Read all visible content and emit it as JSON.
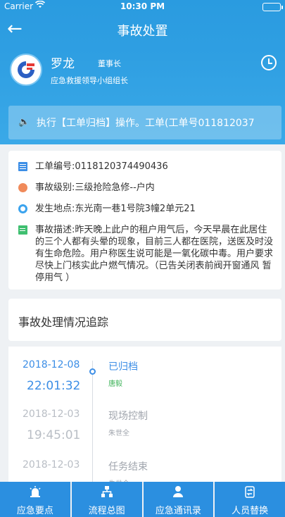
{
  "statusbar": {
    "carrier": "Carrier",
    "time": "10:30 PM"
  },
  "navbar": {
    "back_icon": "←",
    "title": "事故处置"
  },
  "profile": {
    "name": "罗龙",
    "title": "董事长",
    "role": "应急救援领导小组组长"
  },
  "notice": {
    "icon": "🔈",
    "text": "执行【工单归档】操作。工单(工单号011812037"
  },
  "info": {
    "order_no": "工单编号:0118120374490436",
    "level": "事故级别:三级抢险急修--户内",
    "location": "发生地点:东光南一巷1号院3幢2单元21",
    "description": "事故描述:昨天晚上此户的租户用气后，今天早晨在此居住的三个人都有头晕的现象，目前三人都在医院，送医及时没有生命危险。用户称医生说可能是一氧化碳中毒。用户要求尽快上门核实此户燃气情况。（已告关闭表前阀开窗通风 暂停用气 ）"
  },
  "tracking": {
    "title": "事故处理情况追踪",
    "items": [
      {
        "date": "2018-12-08",
        "time": "22:01:32",
        "status": "已归档",
        "person": "唐毅"
      },
      {
        "date": "2018-12-03",
        "time": "19:45:01",
        "status": "现场控制",
        "person": "朱世全"
      },
      {
        "date": "2018-12-03",
        "time": "",
        "status": "任务结束",
        "person": "朱世全"
      }
    ]
  },
  "tabs": [
    {
      "label": "应急要点",
      "icon": "alarm-icon"
    },
    {
      "label": "流程总图",
      "icon": "flowchart-icon"
    },
    {
      "label": "应急通讯录",
      "icon": "contacts-icon"
    },
    {
      "label": "人员替换",
      "icon": "swap-icon"
    }
  ],
  "colors": {
    "primary": "#2b8fe0",
    "accent": "#3c8ee6",
    "success": "#3fb35a"
  }
}
